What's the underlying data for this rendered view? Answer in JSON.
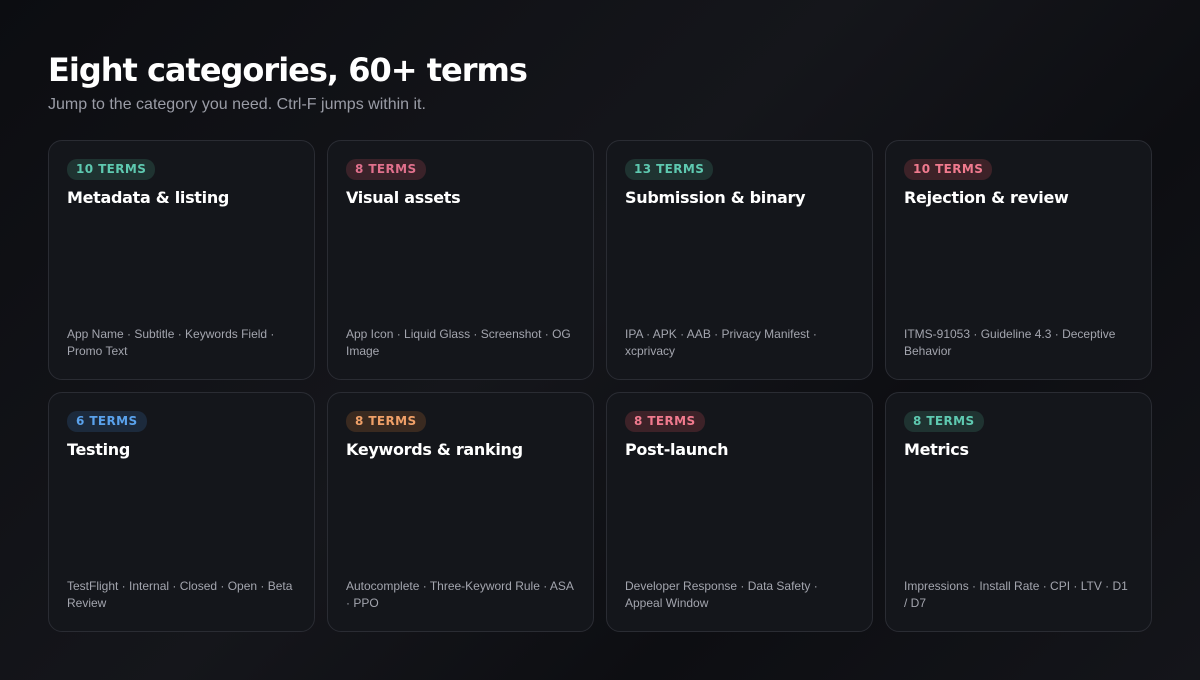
{
  "header": {
    "title": "Eight categories, 60+ terms",
    "subtitle": "Jump to the category you need. Ctrl-F jumps within it."
  },
  "cards": [
    {
      "badge": "10 TERMS",
      "title": "Metadata & listing",
      "terms": "App Name · Subtitle · Keywords Field · Promo Text",
      "badge_color": "#5ec9b0",
      "badge_bg": "#1f3331"
    },
    {
      "badge": "8 TERMS",
      "title": "Visual assets",
      "terms": "App Icon · Liquid Glass · Screenshot · OG Image",
      "badge_color": "#e0708c",
      "badge_bg": "#3a2229"
    },
    {
      "badge": "13 TERMS",
      "title": "Submission & binary",
      "terms": "IPA · APK · AAB · Privacy Manifest · xcprivacy",
      "badge_color": "#5ec9b0",
      "badge_bg": "#1f3331"
    },
    {
      "badge": "10 TERMS",
      "title": "Rejection & review",
      "terms": "ITMS-91053 · Guideline 4.3 · Deceptive Behavior",
      "badge_color": "#f07a8e",
      "badge_bg": "#3d2228"
    },
    {
      "badge": "6 TERMS",
      "title": "Testing",
      "terms": "TestFlight · Internal · Closed · Open · Beta Review",
      "badge_color": "#5aa2ec",
      "badge_bg": "#1c2a3c"
    },
    {
      "badge": "8 TERMS",
      "title": "Keywords & ranking",
      "terms": "Autocomplete · Three-Keyword Rule · ASA · PPO",
      "badge_color": "#f0a068",
      "badge_bg": "#3a2a20"
    },
    {
      "badge": "8 TERMS",
      "title": "Post-launch",
      "terms": "Developer Response · Data Safety · Appeal Window",
      "badge_color": "#f07a8e",
      "badge_bg": "#3d2228"
    },
    {
      "badge": "8 TERMS",
      "title": "Metrics",
      "terms": "Impressions · Install Rate · CPI · LTV · D1 / D7",
      "badge_color": "#5ec9b0",
      "badge_bg": "#1f3331"
    }
  ]
}
